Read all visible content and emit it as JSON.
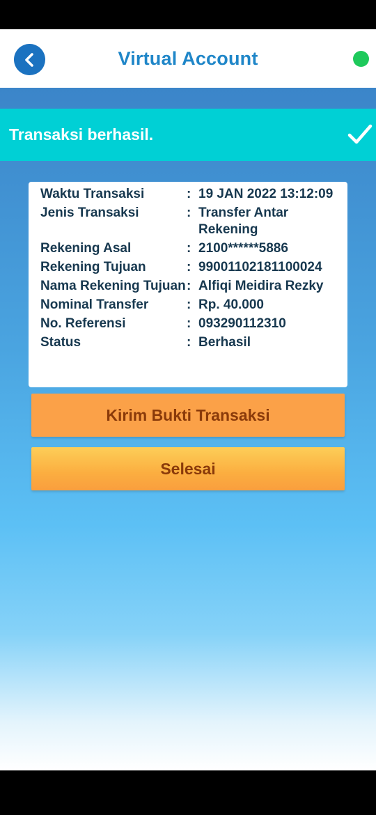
{
  "header": {
    "title": "Virtual Account"
  },
  "banner": {
    "text": "Transaksi berhasil."
  },
  "details": [
    {
      "label": "Waktu Transaksi",
      "value": "19 JAN 2022 13:12:09"
    },
    {
      "label": "Jenis Transaksi",
      "value": "Transfer Antar Rekening"
    },
    {
      "label": "Rekening Asal",
      "value": "2100******5886"
    },
    {
      "label": "Rekening Tujuan",
      "value": "99001102181100024"
    },
    {
      "label": "Nama Rekening Tujuan",
      "value": "Alfiqi Meidira Rezky"
    },
    {
      "label": "Nominal Transfer",
      "value": "Rp. 40.000"
    },
    {
      "label": "No. Referensi",
      "value": "093290112310"
    },
    {
      "label": "Status",
      "value": "Berhasil"
    }
  ],
  "separator": ":",
  "buttons": {
    "send_proof": "Kirim Bukti Transaksi",
    "done": "Selesai"
  },
  "colors": {
    "header_title": "#1f86c8",
    "banner": "#00d0d5",
    "online_dot": "#1ec95b",
    "button_orange": "#fba148"
  },
  "icons": {
    "back": "chevron-left-icon",
    "success": "check-icon",
    "status": "online-dot"
  }
}
